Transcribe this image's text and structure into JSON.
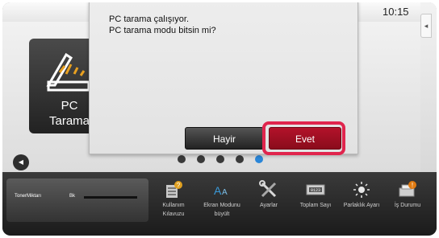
{
  "status": {
    "time": "10:15"
  },
  "home": {
    "tile": {
      "label_line1": "PC",
      "label_line2": "Tarama",
      "icon": "scanner-icon"
    },
    "page_indicator": {
      "count": 5,
      "active_index": 4
    }
  },
  "dialog": {
    "message_line1": "PC tarama çalışıyor.",
    "message_line2": "PC tarama modu bitsin mi?",
    "no_label": "Hayir",
    "yes_label": "Evet",
    "highlight_color": "#e0254d"
  },
  "bottom_bar": {
    "toner": {
      "title": "TonerMiktarı",
      "bk_label": "Bk"
    },
    "items": [
      {
        "label": "Kullanım Kılavuzu",
        "icon": "manual-icon"
      },
      {
        "label": "Ekran Modunu büyült",
        "icon": "enlarge-display-icon"
      },
      {
        "label": "Ayarlar",
        "icon": "settings-tools-icon"
      },
      {
        "label": "Toplam Sayı",
        "icon": "total-count-icon"
      },
      {
        "label": "Parlaklık Ayarı",
        "icon": "brightness-icon"
      },
      {
        "label": "İş Durumu",
        "icon": "job-status-icon"
      }
    ]
  },
  "colors": {
    "accent_blue": "#2a86d8",
    "confirm_red": "#b3122a"
  }
}
